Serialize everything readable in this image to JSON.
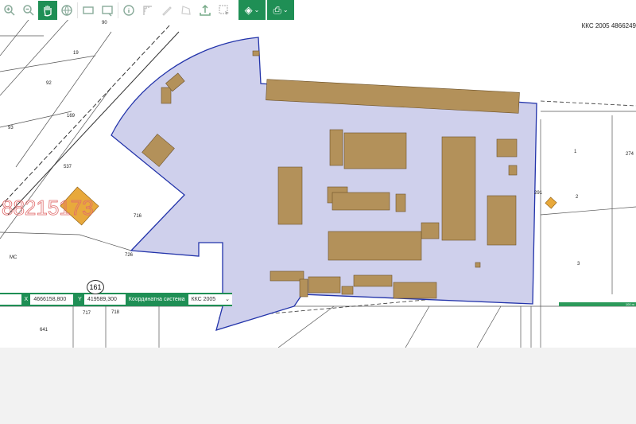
{
  "toolbar": {
    "tools": [
      {
        "name": "zoom-in-icon"
      },
      {
        "name": "zoom-out-icon"
      },
      {
        "name": "pan-hand-icon",
        "active": true
      },
      {
        "name": "globe-icon"
      },
      {
        "name": "select-rect-icon"
      },
      {
        "name": "select-window-icon"
      },
      {
        "name": "info-icon"
      },
      {
        "name": "measure-icon"
      },
      {
        "name": "pencil-icon"
      },
      {
        "name": "polygon-icon"
      },
      {
        "name": "upload-icon"
      },
      {
        "name": "select-cursor-icon"
      }
    ],
    "layers_icon": "layers-icon",
    "print_icon": "print-icon",
    "accent": "#1f8f55"
  },
  "crs_readout": "ККС 2005 4866249",
  "coord_panel": {
    "x_label": "X",
    "x_value": "4666158,800",
    "y_label": "Y",
    "y_value": "419589,300",
    "system_label": "Координатна система",
    "system_value": "ККС 2005"
  },
  "scale_label": "100 m",
  "watermark": "88215173",
  "map_labels": {
    "p90": "90",
    "p19": "19",
    "p92": "92",
    "p93": "93",
    "p169": "169",
    "p537": "537",
    "p716": "716",
    "p726": "726",
    "p161": "161",
    "p717": "717",
    "p718": "718",
    "p641": "641",
    "p274": "274",
    "p1": "1",
    "p2": "2",
    "p3": "3",
    "p291": "291",
    "mc": "МС"
  },
  "colors": {
    "parcel_fill": "#cfd0ec",
    "parcel_stroke": "#2233aa",
    "building": "#b3915a",
    "orange": "#e8a93c"
  }
}
